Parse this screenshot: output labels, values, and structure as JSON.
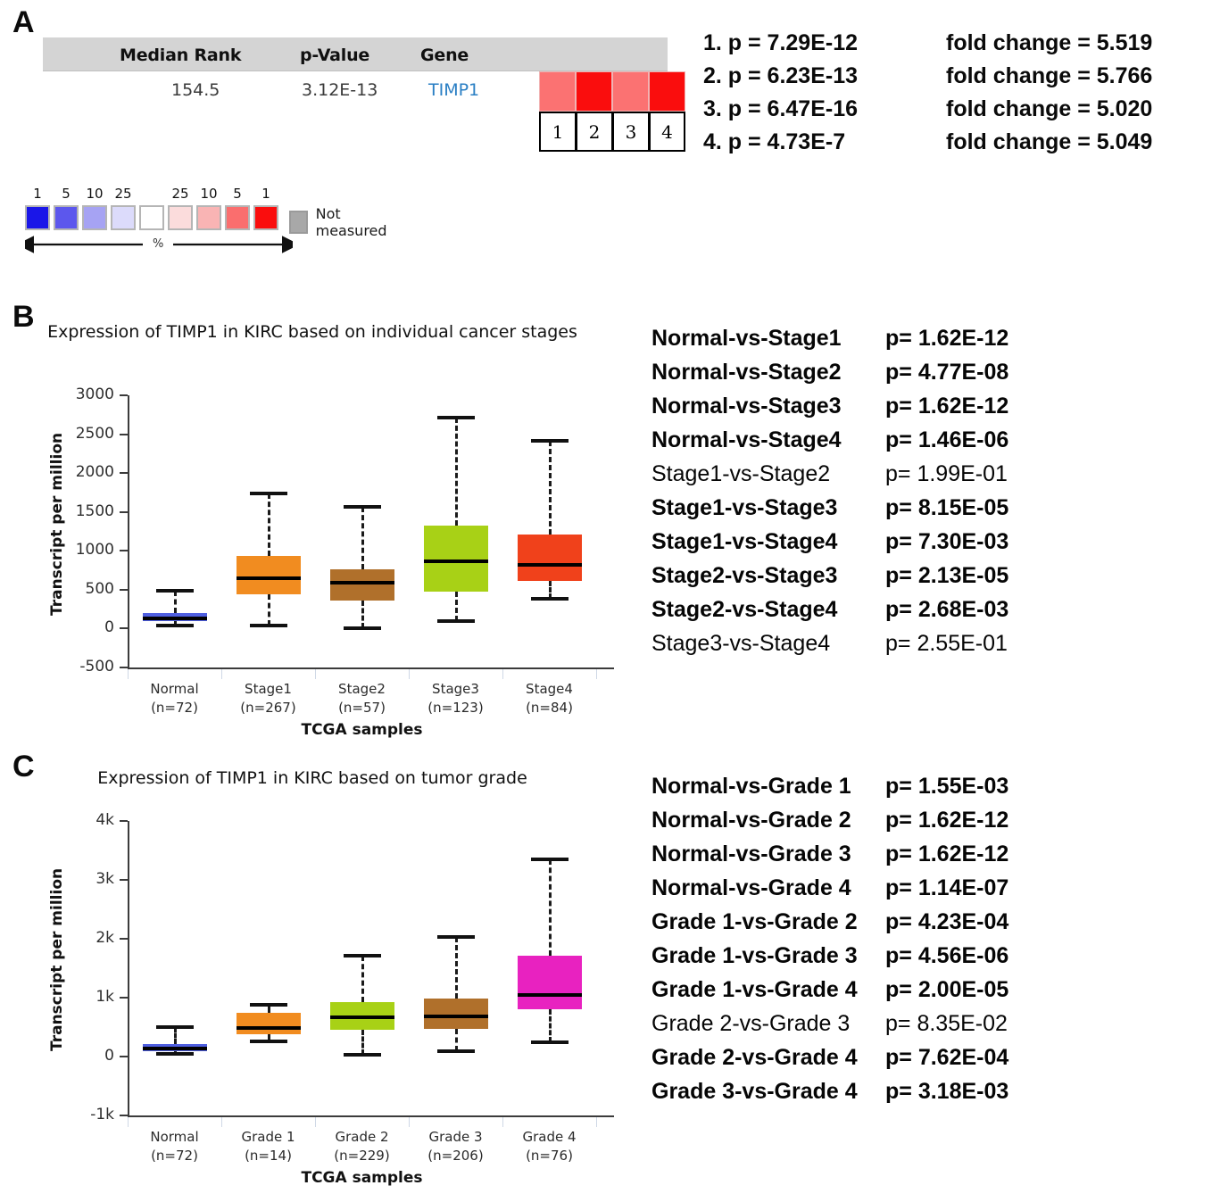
{
  "panels": {
    "a": {
      "letter": "A",
      "table": {
        "headers": {
          "median_rank": "Median Rank",
          "p_value": "p-Value",
          "gene": "Gene"
        },
        "row": {
          "median_rank": "154.5",
          "p_value": "3.12E-13",
          "gene": "TIMP1"
        },
        "cells": [
          {
            "index": "1",
            "color": "#fb7272"
          },
          {
            "index": "2",
            "color": "#fa0d0d"
          },
          {
            "index": "3",
            "color": "#fb7272"
          },
          {
            "index": "4",
            "color": "#fa0d0d"
          }
        ]
      },
      "legend": {
        "left_numbers": [
          "1",
          "5",
          "10",
          "25"
        ],
        "right_numbers": [
          "25",
          "10",
          "5",
          "1"
        ],
        "swatch_colors": [
          "#1a16e8",
          "#5c57ed",
          "#a6a3f3",
          "#dcdbfb",
          "#ffffff",
          "#fbdcdc",
          "#f9b4b4",
          "#fa6e6e",
          "#fa0d0d"
        ],
        "percent_label": "%",
        "not_measured_label": "Not measured",
        "not_measured_color": "#a8a8a8"
      },
      "stats": [
        {
          "label": "1. p = 7.29E-12",
          "fold": "fold change = 5.519"
        },
        {
          "label": "2. p = 6.23E-13",
          "fold": "fold change = 5.766"
        },
        {
          "label": "3. p = 6.47E-16",
          "fold": "fold change = 5.020"
        },
        {
          "label": "4. p = 4.73E-7",
          "fold": "fold change = 5.049"
        }
      ]
    },
    "b": {
      "letter": "B",
      "stats": [
        {
          "comparison": "Normal-vs-Stage1",
          "p": "p= 1.62E-12",
          "bold": true
        },
        {
          "comparison": "Normal-vs-Stage2",
          "p": "p= 4.77E-08",
          "bold": true
        },
        {
          "comparison": "Normal-vs-Stage3",
          "p": "p= 1.62E-12",
          "bold": true
        },
        {
          "comparison": "Normal-vs-Stage4",
          "p": "p= 1.46E-06",
          "bold": true
        },
        {
          "comparison": "Stage1-vs-Stage2",
          "p": "p= 1.99E-01",
          "bold": false
        },
        {
          "comparison": "Stage1-vs-Stage3",
          "p": "p= 8.15E-05",
          "bold": true
        },
        {
          "comparison": "Stage1-vs-Stage4",
          "p": "p= 7.30E-03",
          "bold": true
        },
        {
          "comparison": "Stage2-vs-Stage3",
          "p": "p= 2.13E-05",
          "bold": true
        },
        {
          "comparison": "Stage2-vs-Stage4",
          "p": "p= 2.68E-03",
          "bold": true
        },
        {
          "comparison": "Stage3-vs-Stage4",
          "p": "p= 2.55E-01",
          "bold": false
        }
      ]
    },
    "c": {
      "letter": "C",
      "stats": [
        {
          "comparison": "Normal-vs-Grade 1",
          "p": "p= 1.55E-03",
          "bold": true
        },
        {
          "comparison": "Normal-vs-Grade 2",
          "p": "p= 1.62E-12",
          "bold": true
        },
        {
          "comparison": "Normal-vs-Grade 3",
          "p": "p= 1.62E-12",
          "bold": true
        },
        {
          "comparison": "Normal-vs-Grade 4",
          "p": "p= 1.14E-07",
          "bold": true
        },
        {
          "comparison": "Grade 1-vs-Grade 2",
          "p": "p= 4.23E-04",
          "bold": true
        },
        {
          "comparison": "Grade 1-vs-Grade 3",
          "p": "p= 4.56E-06",
          "bold": true
        },
        {
          "comparison": "Grade 1-vs-Grade 4",
          "p": "p= 2.00E-05",
          "bold": true
        },
        {
          "comparison": "Grade 2-vs-Grade 3",
          "p": "p= 8.35E-02",
          "bold": false
        },
        {
          "comparison": "Grade 2-vs-Grade 4",
          "p": "p= 7.62E-04",
          "bold": true
        },
        {
          "comparison": "Grade 3-vs-Grade 4",
          "p": "p= 3.18E-03",
          "bold": true
        }
      ]
    }
  },
  "chart_data": [
    {
      "id": "chart-b",
      "type": "box",
      "title": "Expression of TIMP1 in KIRC based on individual cancer stages",
      "xlabel": "TCGA samples",
      "ylabel": "Transcript per million",
      "ylim": [
        -500,
        3000
      ],
      "yticks": [
        -500,
        0,
        500,
        1000,
        1500,
        2000,
        2500,
        3000
      ],
      "ytick_labels": [
        "-500",
        "0",
        "500",
        "1000",
        "1500",
        "2000",
        "2500",
        "3000"
      ],
      "grid": false,
      "legend": "none",
      "categories": [
        "Normal",
        "Stage1",
        "Stage2",
        "Stage3",
        "Stage4"
      ],
      "counts": [
        "(n=72)",
        "(n=267)",
        "(n=57)",
        "(n=123)",
        "(n=84)"
      ],
      "boxes": [
        {
          "name": "Normal",
          "color": "#4f5fe0",
          "min": 45,
          "q1": 95,
          "median": 130,
          "q3": 205,
          "max": 490
        },
        {
          "name": "Stage1",
          "color": "#f18c20",
          "min": 40,
          "q1": 445,
          "median": 650,
          "q3": 935,
          "max": 1740
        },
        {
          "name": "Stage2",
          "color": "#b0702b",
          "min": 10,
          "q1": 365,
          "median": 595,
          "q3": 760,
          "max": 1565
        },
        {
          "name": "Stage3",
          "color": "#a8d116",
          "min": 95,
          "q1": 480,
          "median": 870,
          "q3": 1325,
          "max": 2715
        },
        {
          "name": "Stage4",
          "color": "#f0411b",
          "min": 380,
          "q1": 615,
          "median": 825,
          "q3": 1210,
          "max": 2420
        }
      ]
    },
    {
      "id": "chart-c",
      "type": "box",
      "title": "Expression of TIMP1 in KIRC based on tumor grade",
      "xlabel": "TCGA samples",
      "ylabel": "Transcript per million",
      "ylim": [
        -1000,
        4000
      ],
      "yticks": [
        -1000,
        0,
        1000,
        2000,
        3000,
        4000
      ],
      "ytick_labels": [
        "-1k",
        "0",
        "1k",
        "2k",
        "3k",
        "4k"
      ],
      "grid": false,
      "legend": "none",
      "categories": [
        "Normal",
        "Grade 1",
        "Grade 2",
        "Grade 3",
        "Grade 4"
      ],
      "counts": [
        "(n=72)",
        "(n=14)",
        "(n=229)",
        "(n=206)",
        "(n=76)"
      ],
      "boxes": [
        {
          "name": "Normal",
          "color": "#4f5fe0",
          "min": 45,
          "q1": 95,
          "median": 135,
          "q3": 205,
          "max": 495
        },
        {
          "name": "Grade 1",
          "color": "#f18c20",
          "min": 255,
          "q1": 375,
          "median": 490,
          "q3": 740,
          "max": 875
        },
        {
          "name": "Grade 2",
          "color": "#a8d116",
          "min": 25,
          "q1": 460,
          "median": 660,
          "q3": 930,
          "max": 1710
        },
        {
          "name": "Grade 3",
          "color": "#b0702b",
          "min": 90,
          "q1": 470,
          "median": 685,
          "q3": 990,
          "max": 2025
        },
        {
          "name": "Grade 4",
          "color": "#e822c0",
          "min": 240,
          "q1": 810,
          "median": 1040,
          "q3": 1715,
          "max": 3350
        }
      ]
    }
  ]
}
